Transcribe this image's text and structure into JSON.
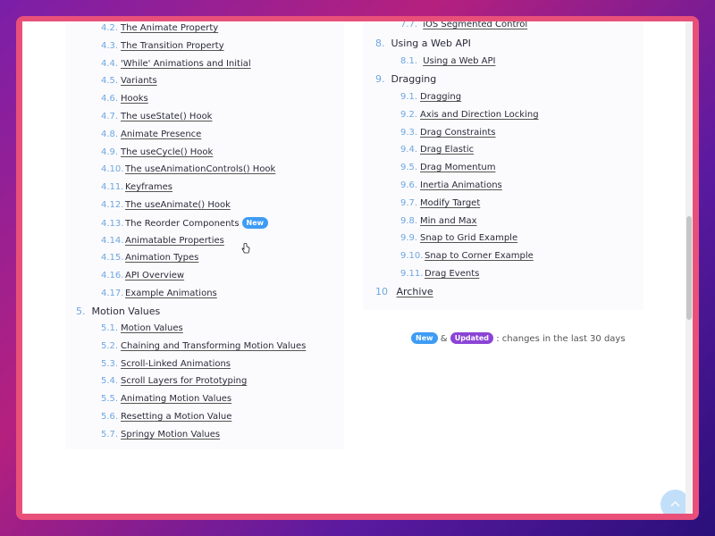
{
  "left_toc": {
    "items": [
      {
        "num": "4.2.",
        "label": "The Animate Property"
      },
      {
        "num": "4.3.",
        "label": "The Transition Property"
      },
      {
        "num": "4.4.",
        "label": "'While' Animations and Initial"
      },
      {
        "num": "4.5.",
        "label": "Variants"
      },
      {
        "num": "4.6.",
        "label": "Hooks"
      },
      {
        "num": "4.7.",
        "label": "The useState() Hook"
      },
      {
        "num": "4.8.",
        "label": "Animate Presence"
      },
      {
        "num": "4.9.",
        "label": "The useCycle() Hook"
      },
      {
        "num": "4.10.",
        "label": "The useAnimationControls() Hook"
      },
      {
        "num": "4.11.",
        "label": "Keyframes"
      },
      {
        "num": "4.12.",
        "label": "The useAnimate() Hook"
      },
      {
        "num": "4.13.",
        "label": "The Reorder Components",
        "badge": "New"
      },
      {
        "num": "4.14.",
        "label": "Animatable Properties"
      },
      {
        "num": "4.15.",
        "label": "Animation Types"
      },
      {
        "num": "4.16.",
        "label": "API Overview"
      },
      {
        "num": "4.17.",
        "label": "Example Animations"
      }
    ],
    "section5": {
      "num": "5.",
      "label": "Motion Values"
    },
    "section5_items": [
      {
        "num": "5.1.",
        "label": "Motion Values"
      },
      {
        "num": "5.2.",
        "label": "Chaining and Transforming Motion Values"
      },
      {
        "num": "5.3.",
        "label": "Scroll-Linked Animations"
      },
      {
        "num": "5.4.",
        "label": "Scroll Layers for Prototyping"
      },
      {
        "num": "5.5.",
        "label": "Animating Motion Values"
      },
      {
        "num": "5.6.",
        "label": "Resetting a Motion Value"
      },
      {
        "num": "5.7.",
        "label": "Springy Motion Values"
      }
    ]
  },
  "right_toc": {
    "top_item": {
      "num": "7.7.",
      "label": "iOS Segmented Control"
    },
    "section8": {
      "num": "8.",
      "label": "Using a Web API"
    },
    "section8_items": [
      {
        "num": "8.1.",
        "label": "Using a Web API"
      }
    ],
    "section9": {
      "num": "9.",
      "label": "Dragging"
    },
    "section9_items": [
      {
        "num": "9.1.",
        "label": "Dragging"
      },
      {
        "num": "9.2.",
        "label": "Axis and Direction Locking"
      },
      {
        "num": "9.3.",
        "label": "Drag Constraints"
      },
      {
        "num": "9.4.",
        "label": "Drag Elastic"
      },
      {
        "num": "9.5.",
        "label": "Drag Momentum"
      },
      {
        "num": "9.6.",
        "label": "Inertia Animations"
      },
      {
        "num": "9.7.",
        "label": "Modify Target"
      },
      {
        "num": "9.8.",
        "label": "Min and Max"
      },
      {
        "num": "9.9.",
        "label": "Snap to Grid Example"
      },
      {
        "num": "9.10.",
        "label": "Snap to Corner Example"
      },
      {
        "num": "9.11.",
        "label": "Drag Events"
      }
    ],
    "section10": {
      "num": "10",
      "label": "Archive"
    }
  },
  "legend": {
    "new_badge": "New",
    "amp": "&",
    "updated_badge": "Updated",
    "text": ": changes in the last 30 days"
  },
  "colors": {
    "accent_blue": "#3d9cf5",
    "accent_purple": "#8b44d6",
    "number_blue": "#6fa6e0",
    "frame_pink": "#e8507a"
  },
  "icons": {
    "scroll_top": "chevron-up-icon",
    "cursor": "hand-pointer-icon"
  }
}
